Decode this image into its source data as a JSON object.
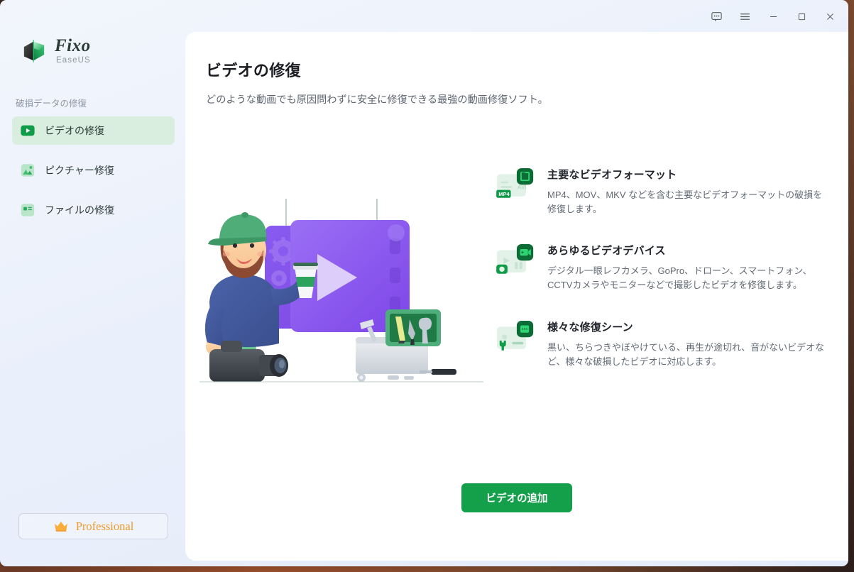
{
  "window": {
    "titlebar_buttons": [
      {
        "name": "feedback",
        "icon": "chat-bubble-icon",
        "label": ""
      },
      {
        "name": "menu",
        "icon": "hamburger-menu-icon",
        "label": ""
      },
      {
        "name": "minimize",
        "icon": "minimize-icon",
        "label": ""
      },
      {
        "name": "maximize",
        "icon": "maximize-icon",
        "label": ""
      },
      {
        "name": "close",
        "icon": "close-icon",
        "label": ""
      }
    ]
  },
  "sidebar": {
    "brand": {
      "name": "Fixo",
      "sub": "EaseUS",
      "logo_icon": "fixo-logo-icon"
    },
    "group_label": "破損データの修復",
    "items": [
      {
        "label": "ビデオの修復",
        "icon": "video-repair-icon",
        "active": true
      },
      {
        "label": "ピクチャー修復",
        "icon": "picture-repair-icon",
        "active": false
      },
      {
        "label": "ファイルの修復",
        "icon": "file-repair-icon",
        "active": false
      }
    ],
    "pro_button": {
      "label": "Professional",
      "icon": "crown-icon"
    }
  },
  "main": {
    "title": "ビデオの修復",
    "subtitle": "どのような動画でも原因問わずに安全に修復できる最強の動画修復ソフト。",
    "illustration_name": "video-repair-illustration",
    "features": [
      {
        "icon": "video-format-icon",
        "title": "主要なビデオフォーマット",
        "desc": "MP4、MOV、MKV などを含む主要なビデオフォーマットの破損を修復します。"
      },
      {
        "icon": "video-device-icon",
        "title": "あらゆるビデオデバイス",
        "desc": "デジタル一眼レフカメラ、GoPro、ドローン、スマートフォン、CCTVカメラやモニターなどで撮影したビデオを修復します。"
      },
      {
        "icon": "repair-scene-icon",
        "title": "様々な修復シーン",
        "desc": "黒い、ちらつきやぼやけている、再生が途切れ、音がないビデオなど、様々な破損したビデオに対応します。"
      }
    ],
    "cta_button": "ビデオの追加"
  },
  "colors": {
    "brand_green": "#14a04a",
    "active_nav_bg": "#d9eede",
    "pro_orange": "#f0992c",
    "card_bg": "#ffffff",
    "sidebar_gradient_start": "#f2f6fc",
    "sidebar_gradient_end": "#e4ebfa",
    "illustration_purple": "#8b5cf6",
    "title_text": "#1b1d22",
    "body_text": "#636a74"
  }
}
